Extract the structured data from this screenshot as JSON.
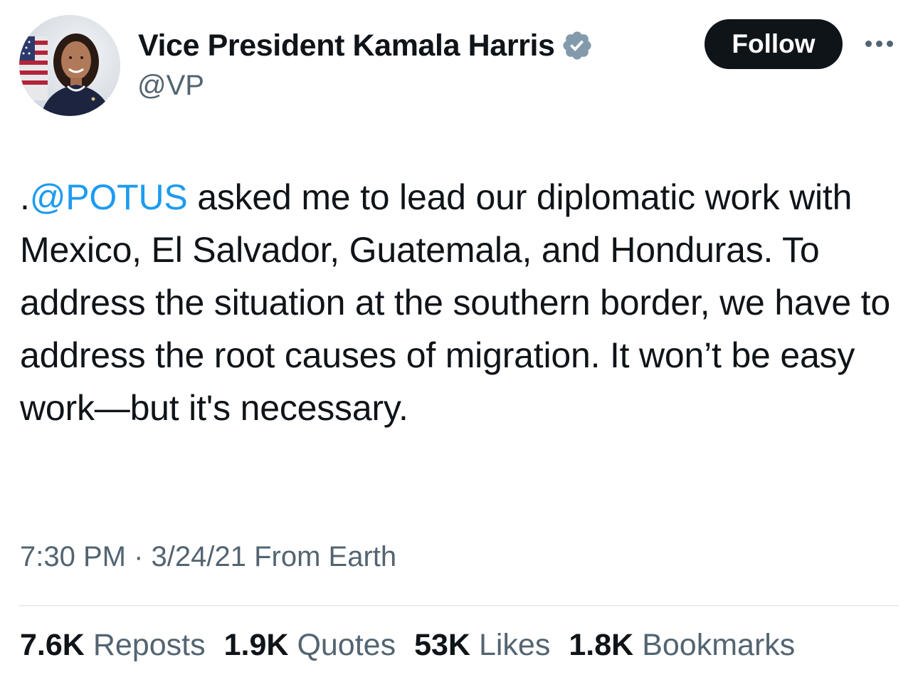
{
  "author": {
    "display_name": "Vice President Kamala Harris",
    "handle": "@VP",
    "verified": true,
    "verified_badge_color": "#829aab",
    "avatar_icon": "profile-photo"
  },
  "actions": {
    "follow_label": "Follow",
    "more_icon": "more-horizontal-icon"
  },
  "tweet": {
    "prefix": ".",
    "mention": "@POTUS",
    "text_after_mention": " asked me to lead our diplomatic work with Mexico, El Salvador, Guatemala, and Honduras. To address the situation at the southern border, we have to address the root causes of migration. It won’t be easy work—but it's necessary."
  },
  "meta": {
    "time": "7:30 PM",
    "separator": " · ",
    "date": "3/24/21",
    "source": "From Earth"
  },
  "stats": [
    {
      "count": "7.6K",
      "label": "Reposts"
    },
    {
      "count": "1.9K",
      "label": "Quotes"
    },
    {
      "count": "53K",
      "label": "Likes"
    },
    {
      "count": "1.8K",
      "label": "Bookmarks"
    }
  ],
  "colors": {
    "text_primary": "#0f1419",
    "text_secondary": "#536471",
    "link": "#1d9bf0",
    "follow_bg": "#0f1419"
  }
}
